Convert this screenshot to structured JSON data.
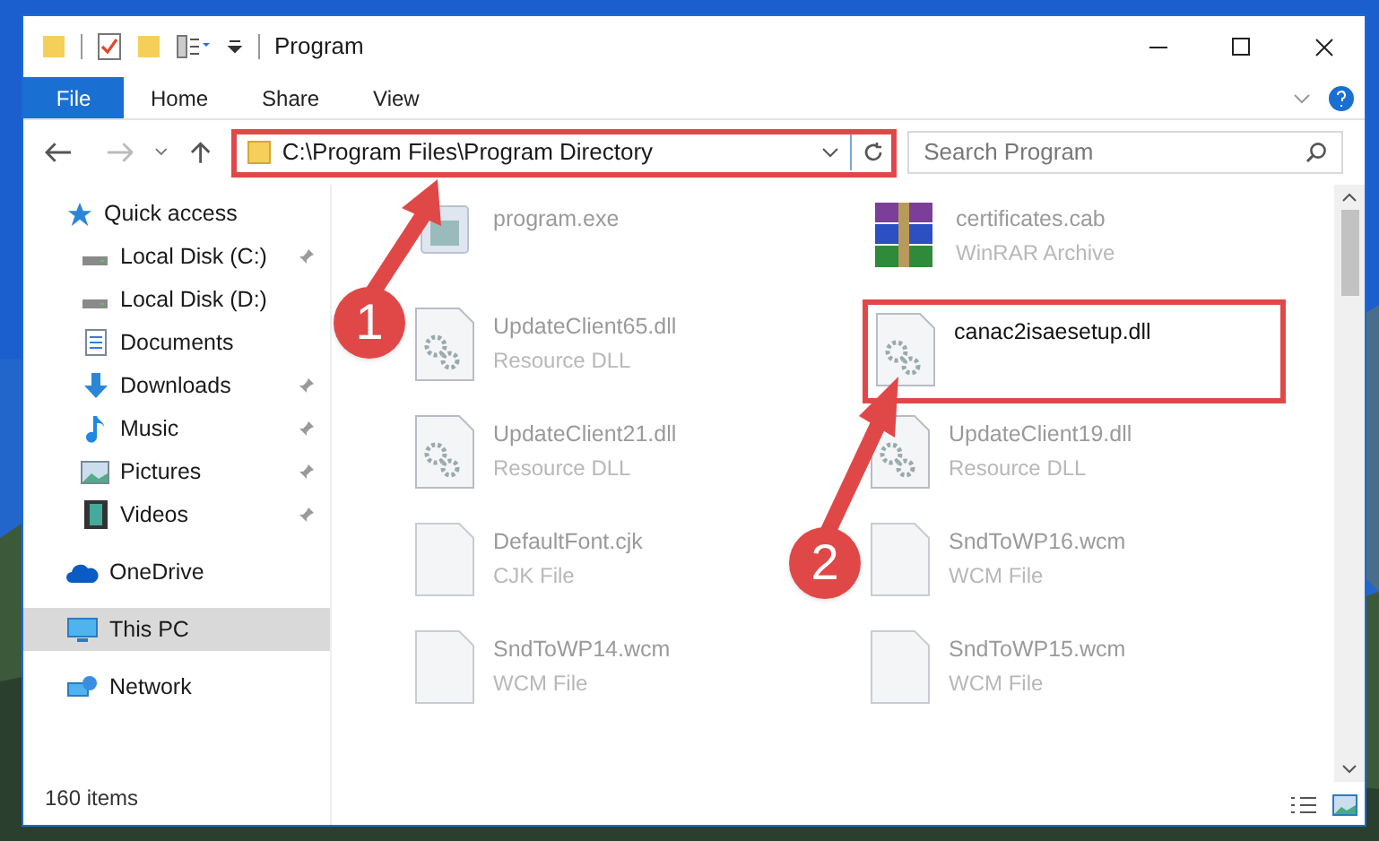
{
  "window": {
    "title": "Program"
  },
  "ribbon_tabs": [
    {
      "label": "File",
      "kind": "file",
      "selected": false
    },
    {
      "label": "Home",
      "kind": "tab",
      "selected": false
    },
    {
      "label": "Share",
      "kind": "tab",
      "selected": false
    },
    {
      "label": "View",
      "kind": "tab",
      "selected": false
    }
  ],
  "address_bar": {
    "path": "C:\\Program Files\\Program Directory",
    "highlighted": true
  },
  "search": {
    "placeholder": "Search Program"
  },
  "sidebar": {
    "items": [
      {
        "label": "Quick access",
        "selected": false,
        "children": [
          {
            "label": "Local Disk (C:)",
            "pinned": true,
            "selected": false
          },
          {
            "label": "Local Disk (D:)",
            "pinned": false,
            "selected": false
          },
          {
            "label": "Documents",
            "pinned": false,
            "selected": false
          },
          {
            "label": "Downloads",
            "pinned": true,
            "selected": false
          },
          {
            "label": "Music",
            "pinned": true,
            "selected": false
          },
          {
            "label": "Pictures",
            "pinned": true,
            "selected": false
          },
          {
            "label": "Videos",
            "pinned": true,
            "selected": false
          }
        ]
      },
      {
        "label": "OneDrive",
        "selected": false
      },
      {
        "label": "This PC",
        "selected": true
      },
      {
        "label": "Network",
        "selected": false
      }
    ]
  },
  "files": [
    {
      "name": "program.exe",
      "kind": "exe",
      "highlighted": false
    },
    {
      "name": "certificates.cab",
      "type": "WinRAR Archive",
      "kind": "archive",
      "highlighted": false
    },
    {
      "name": "UpdateClient65.dll",
      "type": "Resource DLL",
      "kind": "dll",
      "highlighted": false
    },
    {
      "name": "canac2isaesetup.dll",
      "kind": "dll",
      "highlighted": true
    },
    {
      "name": "UpdateClient21.dll",
      "type": "Resource DLL",
      "kind": "dll",
      "highlighted": false
    },
    {
      "name": "UpdateClient19.dll",
      "type": "Resource DLL",
      "kind": "dll",
      "highlighted": false
    },
    {
      "name": "DefaultFont.cjk",
      "type": "CJK File",
      "kind": "file",
      "highlighted": false
    },
    {
      "name": "SndToWP16.wcm",
      "type": "WCM File",
      "kind": "file",
      "highlighted": false
    },
    {
      "name": "SndToWP14.wcm",
      "type": "WCM File",
      "kind": "file",
      "highlighted": false
    },
    {
      "name": "SndToWP15.wcm",
      "type": "WCM File",
      "kind": "file",
      "highlighted": false
    }
  ],
  "status_bar": {
    "item_count": "160 items"
  },
  "annotations": [
    {
      "label": "1"
    },
    {
      "label": "2"
    }
  ]
}
